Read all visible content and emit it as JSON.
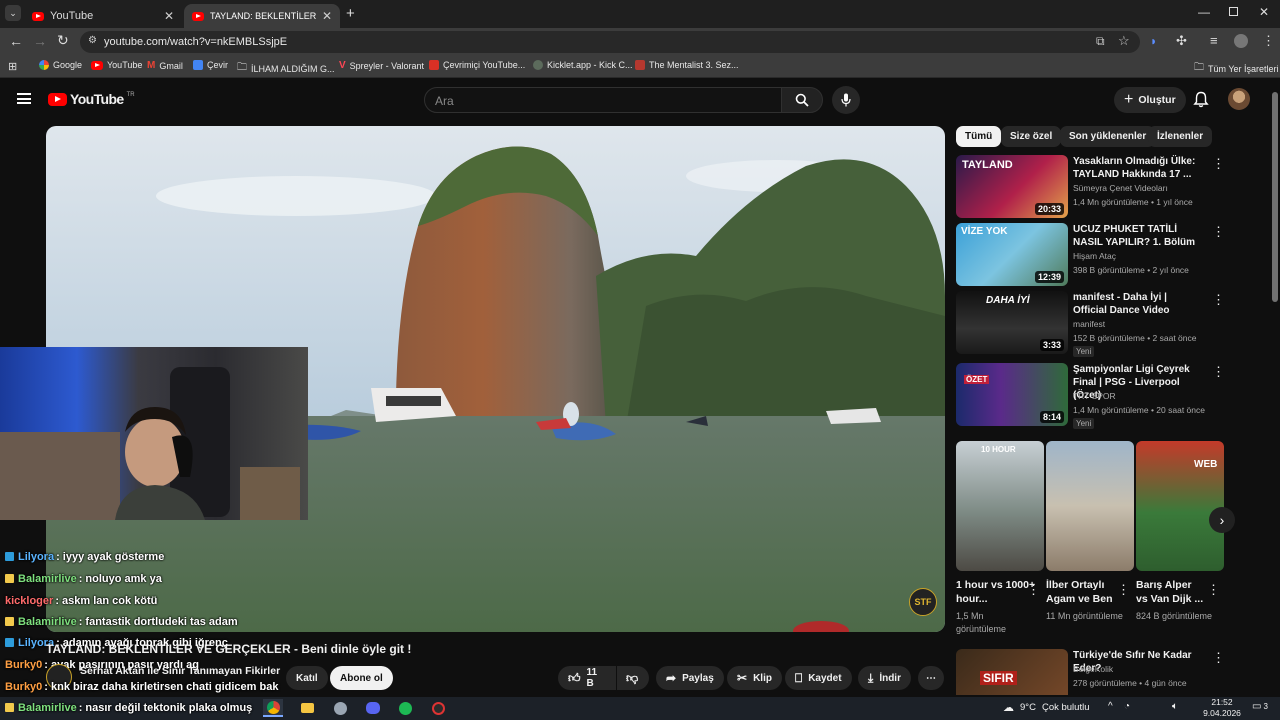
{
  "browser": {
    "tabs": [
      {
        "title": "YouTube",
        "active": false
      },
      {
        "title": "TAYLAND: BEKLENTİLER VE GER",
        "active": true
      }
    ],
    "new_tab_icon": "plus-icon",
    "url": "youtube.com/watch?v=nkEMBLSsjpE",
    "bookmarks": [
      {
        "label": "Google",
        "icon": "google-icon"
      },
      {
        "label": "YouTube",
        "icon": "youtube-icon"
      },
      {
        "label": "Gmail",
        "icon": "gmail-icon"
      },
      {
        "label": "Çevir",
        "icon": "translate-icon"
      },
      {
        "label": "İLHAM ALDIĞIM G...",
        "icon": "folder-icon"
      },
      {
        "label": "Spreyler - Valorant",
        "icon": "valorant-icon"
      },
      {
        "label": "Çevrimiçi YouTube...",
        "icon": "converter-icon"
      },
      {
        "label": "Kicklet.app - Kick C...",
        "icon": "kicklet-icon"
      },
      {
        "label": "The Mentalist 3. Sez...",
        "icon": "tv-icon"
      }
    ],
    "all_bookmarks": "Tüm Yer İşaretleri"
  },
  "youtube": {
    "logo_text": "YouTube",
    "logo_region": "TR",
    "search_placeholder": "Ara",
    "create_label": "Oluştur",
    "video": {
      "title": "TAYLAND: BEKLENTİLER VE GERÇEKLER - Beni dinle öyle git !",
      "channel_name": "Serhat Aktan ile Sınır Tanımayan Fikirler",
      "join_label": "Katıl",
      "subscribe_label": "Abone ol",
      "like_count": "11 B",
      "share_label": "Paylaş",
      "clip_label": "Klip",
      "save_label": "Kaydet",
      "download_label": "İndir",
      "watermark": "STF"
    },
    "chips": [
      "Tümü",
      "Size özel",
      "Son yüklenenler",
      "İzlenenler"
    ],
    "recommendations": [
      {
        "title": "Yasakların Olmadığı Ülke: TAYLAND Hakkında 17 ...",
        "channel": "Sümeyra Çenet Videoları",
        "meta": "1,4 Mn görüntüleme • 1 yıl önce",
        "duration": "20:33",
        "thumb_text": "TAYLAND",
        "new": ""
      },
      {
        "title": "UCUZ PHUKET TATİLİ NASIL YAPILIR? 1. Bölüm",
        "channel": "Hişam Ataç",
        "meta": "398 B görüntüleme • 2 yıl önce",
        "duration": "12:39",
        "thumb_text": "VİZE YOK",
        "new": ""
      },
      {
        "title": "manifest - Daha İyi | Official Dance Video",
        "channel": "manifest",
        "meta": "152 B görüntüleme • 2 saat önce",
        "duration": "3:33",
        "thumb_text": "DAHA İYİ",
        "new": "Yeni"
      },
      {
        "title": "Şampiyonlar Ligi Çeyrek Final | PSG - Liverpool (Özet)",
        "channel": "TRT SPOR",
        "meta": "1,4 Mn görüntüleme • 20 saat önce",
        "duration": "8:14",
        "thumb_text": "ÖZET",
        "new": "Yeni"
      }
    ],
    "shorts": [
      {
        "title": "1 hour vs 1000+ hour...",
        "views": "1,5 Mn görüntüleme",
        "thumb_text": "10 HOUR"
      },
      {
        "title": "İlber Ortaylı Agam ve Ben",
        "views": "11 Mn görüntüleme",
        "thumb_text": ""
      },
      {
        "title": "Barış Alper vs Van Dijk ...",
        "views": "824 B görüntüleme",
        "thumb_text": "WEB"
      }
    ],
    "last_rec": {
      "title": "Türkiye'de Sıfır Ne Kadar Eder?",
      "channel": "BelgeKolik",
      "meta": "278 görüntüleme • 4 gün önce",
      "thumb_text": "SIFIR"
    }
  },
  "stream_chat": [
    {
      "user": "Lilyora",
      "msg": ": iyyy ayak gösterme",
      "user_color": "#5ab4ff",
      "badge_color": "#2d9cdb"
    },
    {
      "user": "Balamirlive",
      "msg": ": noluyo amk ya",
      "user_color": "#7ee07e",
      "badge_color": "#f2c94c"
    },
    {
      "user": "kickloger",
      "msg": ": askm lan cok kötü",
      "user_color": "#ff6b6b",
      "badge_color": ""
    },
    {
      "user": "Balamirlive",
      "msg": ": fantastik dortludeki tas adam",
      "user_color": "#7ee07e",
      "badge_color": "#f2c94c"
    },
    {
      "user": "Lilyora",
      "msg": ": adamın ayağı toprak gibi iğrenç",
      "user_color": "#5ab4ff",
      "badge_color": "#2d9cdb"
    },
    {
      "user": "Burky0",
      "msg": ": ayak pasırının pasır yardı ag",
      "user_color": "#ff9f43",
      "badge_color": ""
    },
    {
      "user": "Burky0",
      "msg": ": knk biraz daha kirletirsen chati gidicem bak",
      "user_color": "#ff9f43",
      "badge_color": ""
    },
    {
      "user": "Balamirlive",
      "msg": ": nasır değil tektonik plaka olmuş",
      "user_color": "#7ee07e",
      "badge_color": "#f2c94c"
    }
  ],
  "taskbar": {
    "weather_temp": "9°C",
    "weather_text": "Çok bulutlu",
    "time": "21:52",
    "date": "9.04.2026",
    "notifications": "3"
  },
  "colors": {
    "yt_red": "#ff0000",
    "bg": "#0f0f0f",
    "chip": "#272727"
  }
}
